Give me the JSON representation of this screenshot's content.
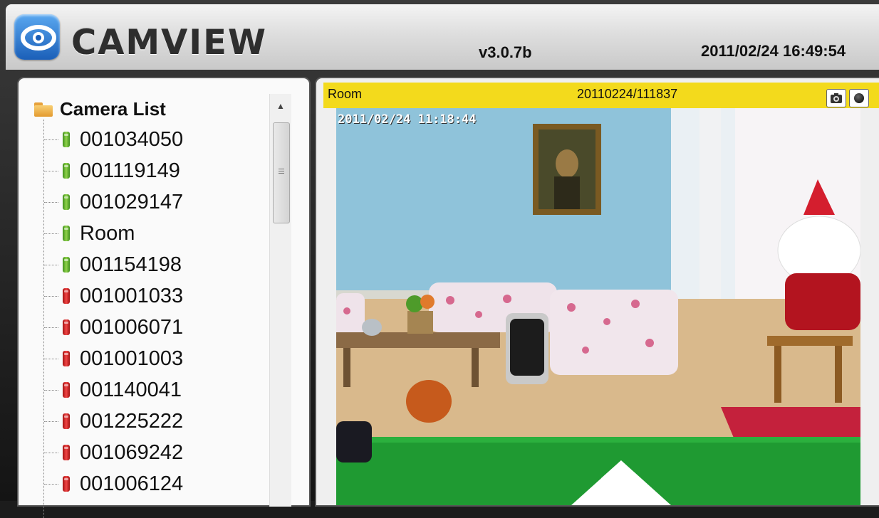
{
  "app": {
    "logo_text": "CAMVIEW",
    "version": "v3.0.7b",
    "datetime": "2011/02/24 16:49:54"
  },
  "camera_list": {
    "title": "Camera List",
    "items": [
      {
        "label": "001034050",
        "status": "online"
      },
      {
        "label": "001119149",
        "status": "online"
      },
      {
        "label": "001029147",
        "status": "online"
      },
      {
        "label": "Room",
        "status": "online"
      },
      {
        "label": "001154198",
        "status": "online"
      },
      {
        "label": "001001033",
        "status": "offline"
      },
      {
        "label": "001006071",
        "status": "offline"
      },
      {
        "label": "001001003",
        "status": "offline"
      },
      {
        "label": "001140041",
        "status": "offline"
      },
      {
        "label": "001225222",
        "status": "offline"
      },
      {
        "label": "001069242",
        "status": "offline"
      },
      {
        "label": "001006124",
        "status": "offline"
      }
    ]
  },
  "viewer": {
    "camera_name": "Room",
    "recording_id": "20110224/111837",
    "osd_timestamp": "2011/02/24 11:18:44",
    "snapshot_icon": "camera-icon",
    "record_icon": "record-icon"
  },
  "colors": {
    "title_bar": "#f3da1c",
    "online": "#6fbf35",
    "offline": "#d62a2a"
  }
}
